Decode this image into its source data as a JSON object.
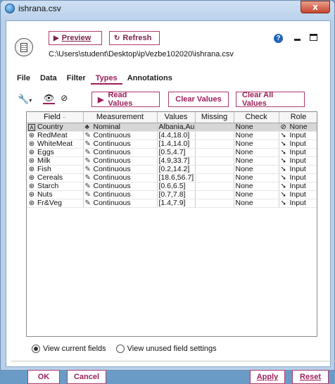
{
  "window": {
    "title": "ishrana.csv",
    "close_glyph": "x"
  },
  "header": {
    "preview_label": "Preview",
    "refresh_label": "Refresh",
    "path": "C:\\Users\\student\\Desktop\\ipVezbe102020\\ishrana.csv"
  },
  "tabs": [
    "File",
    "Data",
    "Filter",
    "Types",
    "Annotations"
  ],
  "active_tab": "Types",
  "toolbar": {
    "read_values_label": "Read Values",
    "clear_values_label": "Clear Values",
    "clear_all_values_label": "Clear All Values"
  },
  "table": {
    "columns": [
      "Field",
      "Measurement",
      "Values",
      "Missing",
      "Check",
      "Role"
    ],
    "rows": [
      {
        "field": "Country",
        "measurement": "Nominal",
        "values": "Albania,Au...",
        "missing": "",
        "check": "None",
        "role": "None"
      },
      {
        "field": "RedMeat",
        "measurement": "Continuous",
        "values": "[4.4,18.0]",
        "missing": "",
        "check": "None",
        "role": "Input"
      },
      {
        "field": "WhiteMeat",
        "measurement": "Continuous",
        "values": "[1.4,14.0]",
        "missing": "",
        "check": "None",
        "role": "Input"
      },
      {
        "field": "Eggs",
        "measurement": "Continuous",
        "values": "[0.5,4.7]",
        "missing": "",
        "check": "None",
        "role": "Input"
      },
      {
        "field": "Milk",
        "measurement": "Continuous",
        "values": "[4.9,33.7]",
        "missing": "",
        "check": "None",
        "role": "Input"
      },
      {
        "field": "Fish",
        "measurement": "Continuous",
        "values": "[0.2,14.2]",
        "missing": "",
        "check": "None",
        "role": "Input"
      },
      {
        "field": "Cereals",
        "measurement": "Continuous",
        "values": "[18.6,56.7]",
        "missing": "",
        "check": "None",
        "role": "Input"
      },
      {
        "field": "Starch",
        "measurement": "Continuous",
        "values": "[0.6,6.5]",
        "missing": "",
        "check": "None",
        "role": "Input"
      },
      {
        "field": "Nuts",
        "measurement": "Continuous",
        "values": "[0.7,7.8]",
        "missing": "",
        "check": "None",
        "role": "Input"
      },
      {
        "field": "Fr&Veg",
        "measurement": "Continuous",
        "values": "[1.4,7.9]",
        "missing": "",
        "check": "None",
        "role": "Input"
      }
    ]
  },
  "view_options": {
    "current_label": "View current fields",
    "unused_label": "View unused field settings",
    "selected": "current"
  },
  "footer": {
    "ok_label": "OK",
    "cancel_label": "Cancel",
    "apply_label": "Apply",
    "reset_label": "Reset"
  },
  "colors": {
    "accent": "#9b1f5b",
    "selected_row": "#d7d7d7"
  }
}
